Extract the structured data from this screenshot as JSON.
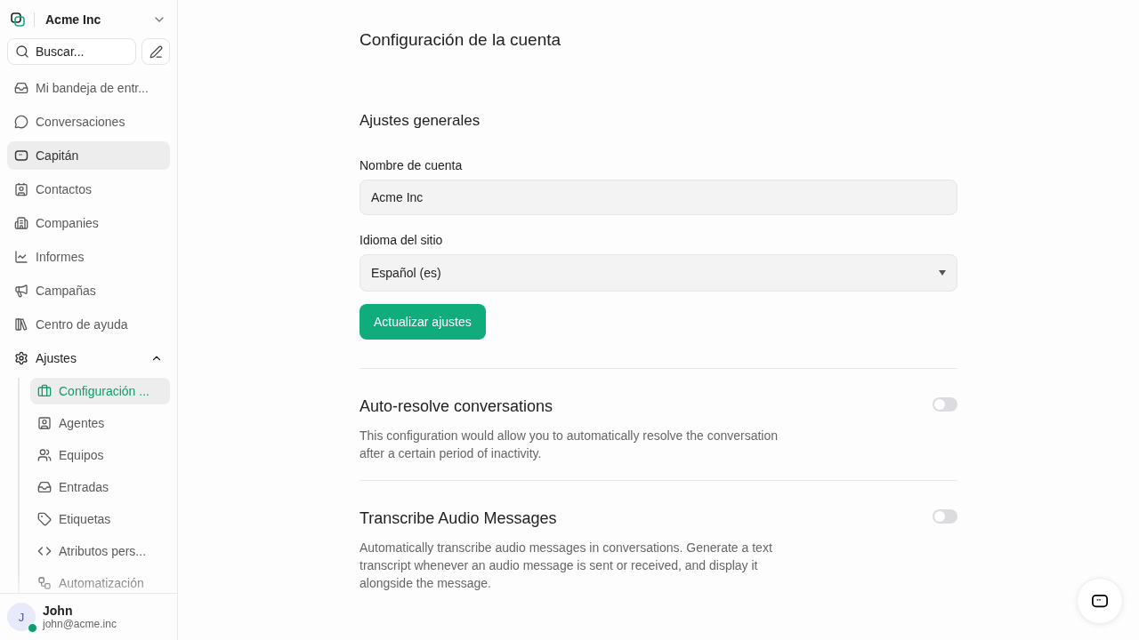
{
  "sidebar": {
    "account": "Acme Inc",
    "search": {
      "placeholder": "Buscar..."
    },
    "items": [
      {
        "label": "Mi bandeja de entr...",
        "selected": false
      },
      {
        "label": "Conversaciones",
        "selected": false
      },
      {
        "label": "Capitán",
        "selected": true
      },
      {
        "label": "Contactos",
        "selected": false
      },
      {
        "label": "Companies",
        "selected": false
      },
      {
        "label": "Informes",
        "selected": false
      },
      {
        "label": "Campañas",
        "selected": false
      },
      {
        "label": "Centro de ayuda",
        "selected": false
      },
      {
        "label": "Ajustes",
        "selected": false,
        "expanded": true,
        "children": [
          {
            "label": "Configuración ...",
            "selected": true
          },
          {
            "label": "Agentes",
            "selected": false
          },
          {
            "label": "Equipos",
            "selected": false
          },
          {
            "label": "Entradas",
            "selected": false
          },
          {
            "label": "Etiquetas",
            "selected": false
          },
          {
            "label": "Atributos pers...",
            "selected": false
          },
          {
            "label": "Automatización",
            "selected": false
          }
        ]
      }
    ],
    "user": {
      "initial": "J",
      "name": "John",
      "email": "john@acme.inc",
      "online": true
    }
  },
  "page": {
    "title": "Configuración de la cuenta",
    "section": "Ajustes generales",
    "fields": [
      {
        "kind": "text",
        "label": "Nombre de cuenta",
        "value": "Acme Inc"
      },
      {
        "kind": "select",
        "label": "Idioma del sitio",
        "value": "Español (es)"
      }
    ],
    "submit": "Actualizar ajustes",
    "toggles": [
      {
        "title": "Auto-resolve conversations",
        "description": "This configuration would allow you to automatically resolve the conversation after a certain period of inactivity.",
        "on": false
      },
      {
        "title": "Transcribe Audio Messages",
        "description": "Automatically transcribe audio messages in conversations. Generate a text transcript whenever an audio message is sent or received, and display it alongside the message.",
        "on": false
      }
    ]
  }
}
